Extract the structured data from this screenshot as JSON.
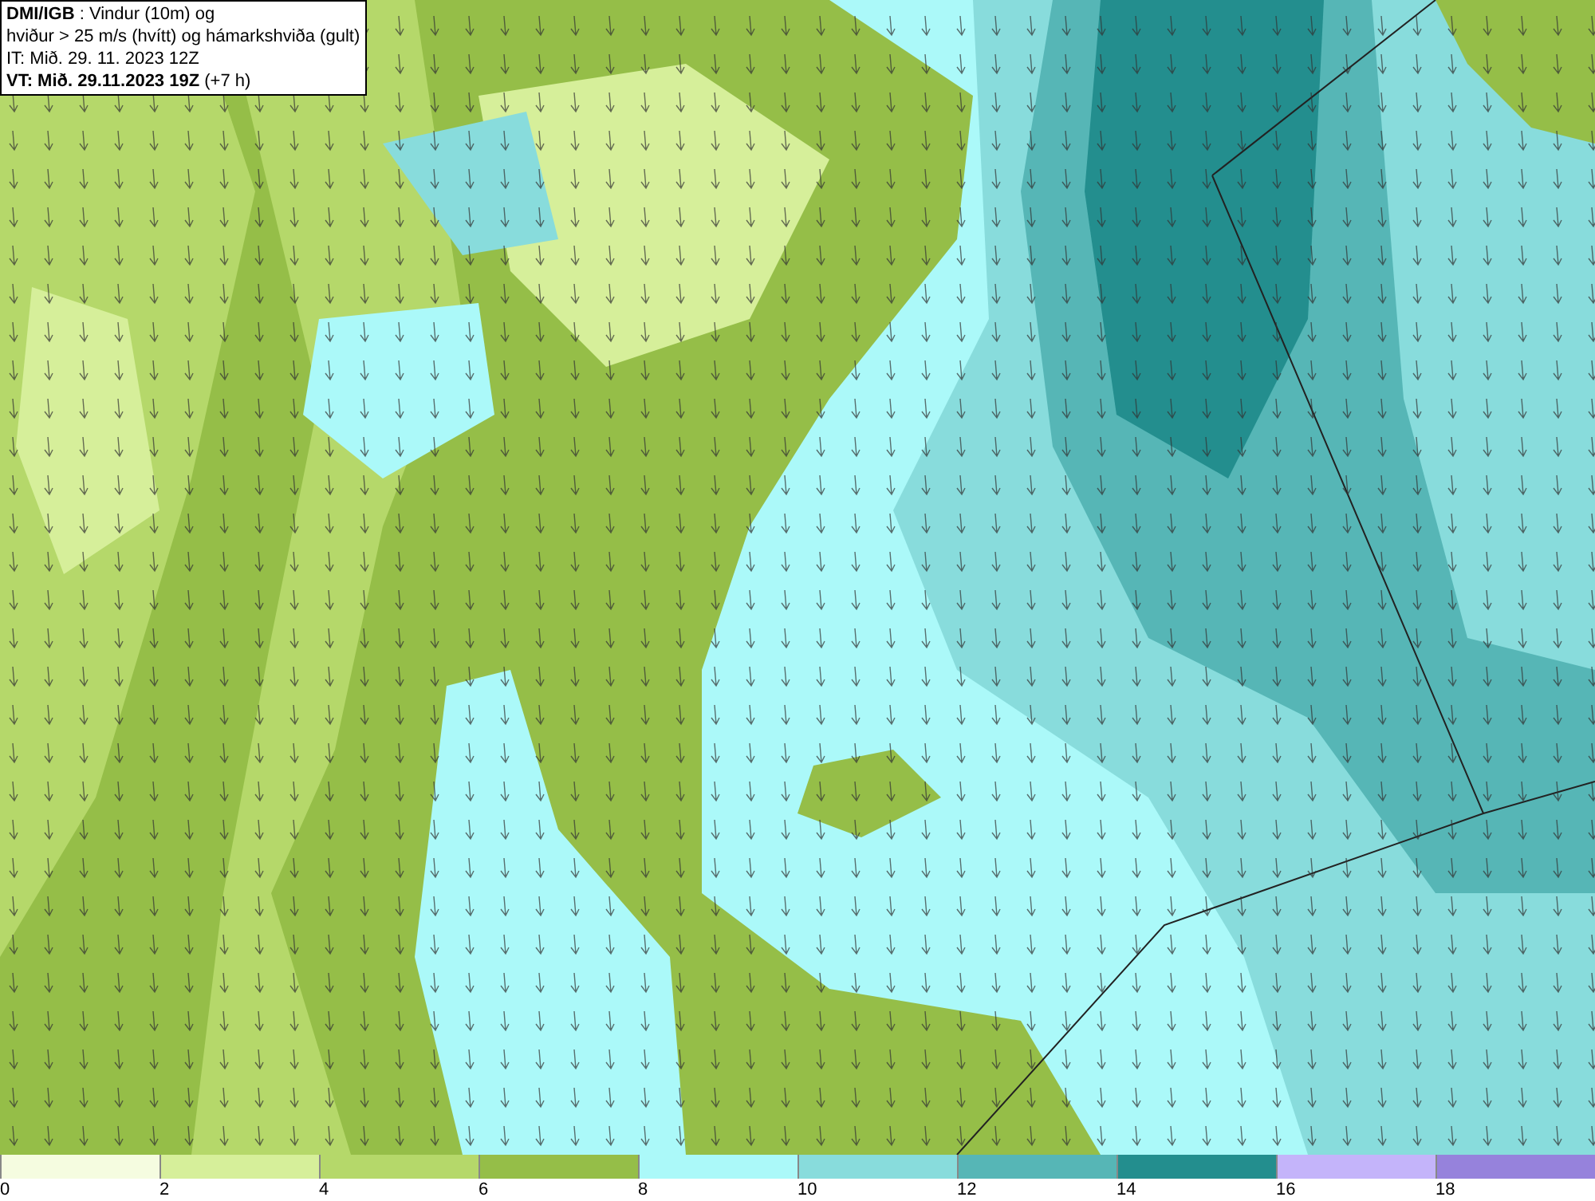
{
  "title_box": {
    "lines": [
      "**DMI/IGB** : Vindur (10m) og",
      "hviður > 25 m/s (hvítt) og hámarkshviða (gult)",
      "IT: Mið. 29. 11. 2023 12Z",
      "**VT: Mið. 29.11.2023 19Z** (+7 h)"
    ]
  },
  "legend": {
    "bins": [
      {
        "label": "0",
        "color": "#f5fce0"
      },
      {
        "label": "2",
        "color": "#d6ef9a"
      },
      {
        "label": "4",
        "color": "#b5d86a"
      },
      {
        "label": "6",
        "color": "#95be48"
      },
      {
        "label": "8",
        "color": "#abf9f9"
      },
      {
        "label": "10",
        "color": "#88dcdc"
      },
      {
        "label": "12",
        "color": "#56b6b6"
      },
      {
        "label": "14",
        "color": "#238e8e"
      },
      {
        "label": "16",
        "color": "#c4b4fa"
      },
      {
        "label": "18",
        "color": "#9682dc"
      }
    ]
  }
}
